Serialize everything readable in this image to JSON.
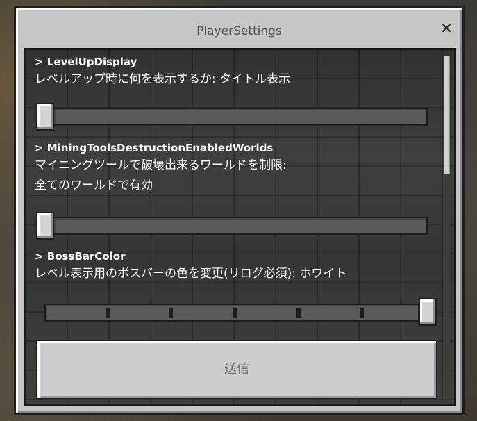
{
  "dialog": {
    "title": "PlayerSettings",
    "close_glyph": "✕"
  },
  "settings": [
    {
      "name": "> LevelUpDisplay",
      "desc_lines": [
        "レベルアップ時に何を表示するか: タイトル表示"
      ],
      "slider_value": 0,
      "slider_steps": 0
    },
    {
      "name": "> MiningToolsDestructionEnabledWorlds",
      "desc_lines": [
        "マイニングツールで破壊出来るワールドを制限:",
        "全てのワールドで有効"
      ],
      "slider_value": 0,
      "slider_steps": 0
    },
    {
      "name": "> BossBarColor",
      "desc_lines": [
        "レベル表示用のボスバーの色を変更(リログ必須): ホワイト"
      ],
      "slider_value": 6,
      "slider_steps": 6
    }
  ],
  "submit_label": "送信",
  "icons": {
    "close": "close-icon"
  },
  "colors": {
    "dialog_bg": "#c6c6c6",
    "panel_bg": "#2f2f2f",
    "text_light": "#ffffff",
    "button_text": "#707070"
  }
}
